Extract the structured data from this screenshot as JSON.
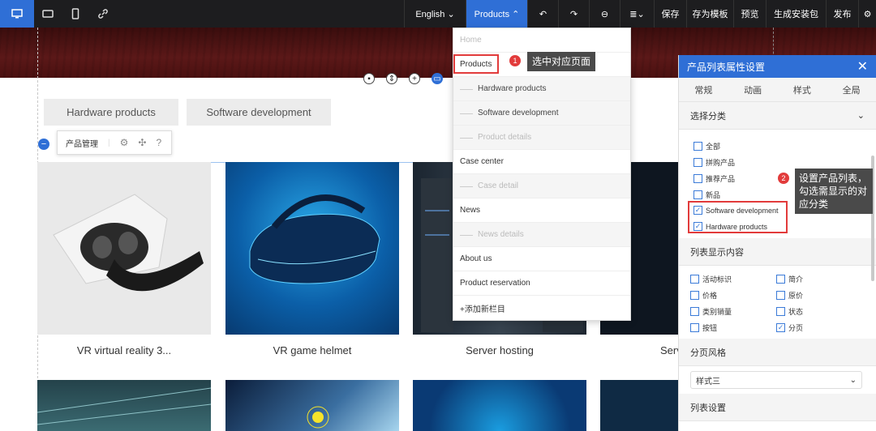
{
  "topbar": {
    "language": "English ⌄",
    "products": "Products ⌃",
    "save": "保存",
    "save_template": "存为模板",
    "preview": "预览",
    "gen_package": "生成安装包",
    "publish": "发布"
  },
  "tabs": [
    "Hardware products",
    "Software development"
  ],
  "toolbar2": {
    "label": "产品管理"
  },
  "products": [
    {
      "name": "VR virtual reality 3..."
    },
    {
      "name": "VR game helmet"
    },
    {
      "name": "Server hosting"
    },
    {
      "name": "Serv"
    }
  ],
  "dropdown": {
    "items": [
      {
        "label": "Home",
        "type": "dim"
      },
      {
        "label": "Products",
        "type": "normal"
      },
      {
        "label": "Hardware products",
        "type": "sub"
      },
      {
        "label": "Software development",
        "type": "sub"
      },
      {
        "label": "Product details",
        "type": "subdim"
      },
      {
        "label": "Case center",
        "type": "normal"
      },
      {
        "label": "Case detail",
        "type": "subdim"
      },
      {
        "label": "News",
        "type": "normal"
      },
      {
        "label": "News details",
        "type": "subdim"
      },
      {
        "label": "About us",
        "type": "normal"
      },
      {
        "label": "Product reservation",
        "type": "normal"
      },
      {
        "label": "+添加新栏目",
        "type": "normal"
      }
    ]
  },
  "tips": {
    "tip1": "选中对应页面",
    "tip2": "设置产品列表，勾选需显示的对应分类",
    "badge1": "1",
    "badge2": "2"
  },
  "panel": {
    "title": "产品列表属性设置",
    "tabs": [
      "常规",
      "动画",
      "样式",
      "全局"
    ],
    "sec_category": "选择分类",
    "categories": [
      {
        "label": "全部",
        "checked": false
      },
      {
        "label": "拼购产品",
        "checked": false
      },
      {
        "label": "推荐产品",
        "checked": false
      },
      {
        "label": "新品",
        "checked": false
      },
      {
        "label": "Software development",
        "checked": true
      },
      {
        "label": "Hardware products",
        "checked": true
      }
    ],
    "sec_display": "列表显示内容",
    "display_left": [
      {
        "label": "活动标识",
        "checked": false
      },
      {
        "label": "价格",
        "checked": false
      },
      {
        "label": "类别销量",
        "checked": false
      },
      {
        "label": "按钮",
        "checked": false
      }
    ],
    "display_right": [
      {
        "label": "简介",
        "checked": false
      },
      {
        "label": "原价",
        "checked": false
      },
      {
        "label": "状态",
        "checked": false
      },
      {
        "label": "分页",
        "checked": true
      }
    ],
    "sec_paging": "分页风格",
    "paging_value": "样式三",
    "sec_list": "列表设置"
  },
  "colors": {
    "accent": "#2f6fd6",
    "annotation": "#e23b3b",
    "topbar": "#1d1d1f"
  }
}
